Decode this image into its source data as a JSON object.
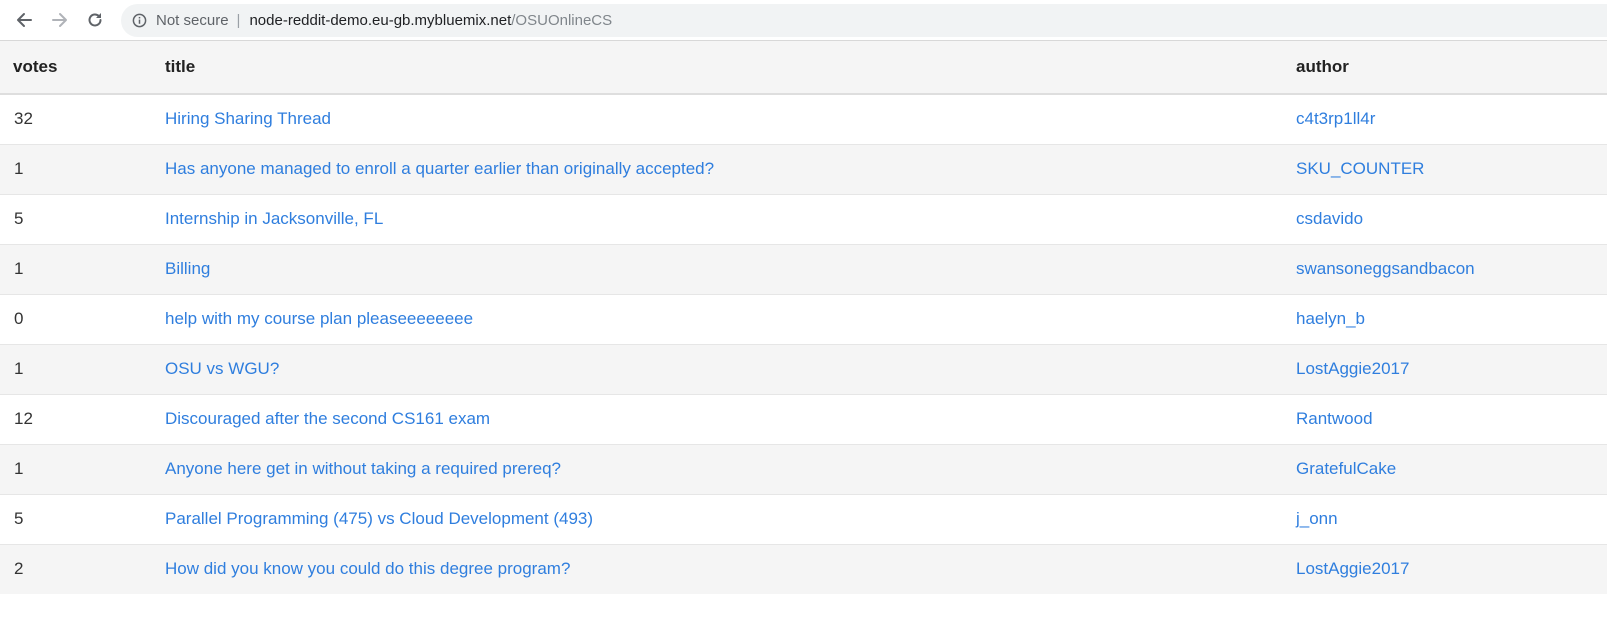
{
  "browser": {
    "security_text": "Not secure",
    "separator": "|",
    "url_host": "node-reddit-demo.eu-gb.mybluemix.net",
    "url_path": "/OSUOnlineCS"
  },
  "table": {
    "headers": {
      "votes": "votes",
      "title": "title",
      "author": "author"
    },
    "rows": [
      {
        "votes": "32",
        "title": "Hiring Sharing Thread",
        "author": "c4t3rp1ll4r"
      },
      {
        "votes": "1",
        "title": "Has anyone managed to enroll a quarter earlier than originally accepted?",
        "author": "SKU_COUNTER"
      },
      {
        "votes": "5",
        "title": "Internship in Jacksonville, FL",
        "author": "csdavido"
      },
      {
        "votes": "1",
        "title": "Billing",
        "author": "swansoneggsandbacon"
      },
      {
        "votes": "0",
        "title": "help with my course plan pleaseeeeeeee",
        "author": "haelyn_b"
      },
      {
        "votes": "1",
        "title": "OSU vs WGU?",
        "author": "LostAggie2017"
      },
      {
        "votes": "12",
        "title": "Discouraged after the second CS161 exam",
        "author": "Rantwood"
      },
      {
        "votes": "1",
        "title": "Anyone here get in without taking a required prereq?",
        "author": "GratefulCake"
      },
      {
        "votes": "5",
        "title": "Parallel Programming (475) vs Cloud Development (493)",
        "author": "j_onn"
      },
      {
        "votes": "2",
        "title": "How did you know you could do this degree program?",
        "author": "LostAggie2017"
      }
    ]
  },
  "icons": {
    "back": "arrow-left-icon",
    "forward": "arrow-right-icon",
    "reload": "reload-icon",
    "info": "info-circle-icon"
  },
  "colors": {
    "link": "#2f7ede",
    "stripe": "#f5f5f5"
  }
}
